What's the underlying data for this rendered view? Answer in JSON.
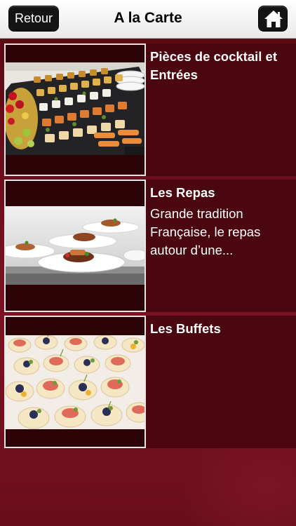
{
  "header": {
    "back_label": "Retour",
    "title": "A la Carte",
    "home_icon": "home-icon"
  },
  "items": [
    {
      "title": "Pièces de cocktail et Entrées",
      "description": ""
    },
    {
      "title": "Les Repas",
      "description": "Grande tradition Française, le repas autour d’une..."
    },
    {
      "title": "Les Buffets",
      "description": ""
    }
  ],
  "colors": {
    "background": "#6a0d18",
    "row_background": "#4a0710",
    "button": "#141414"
  }
}
